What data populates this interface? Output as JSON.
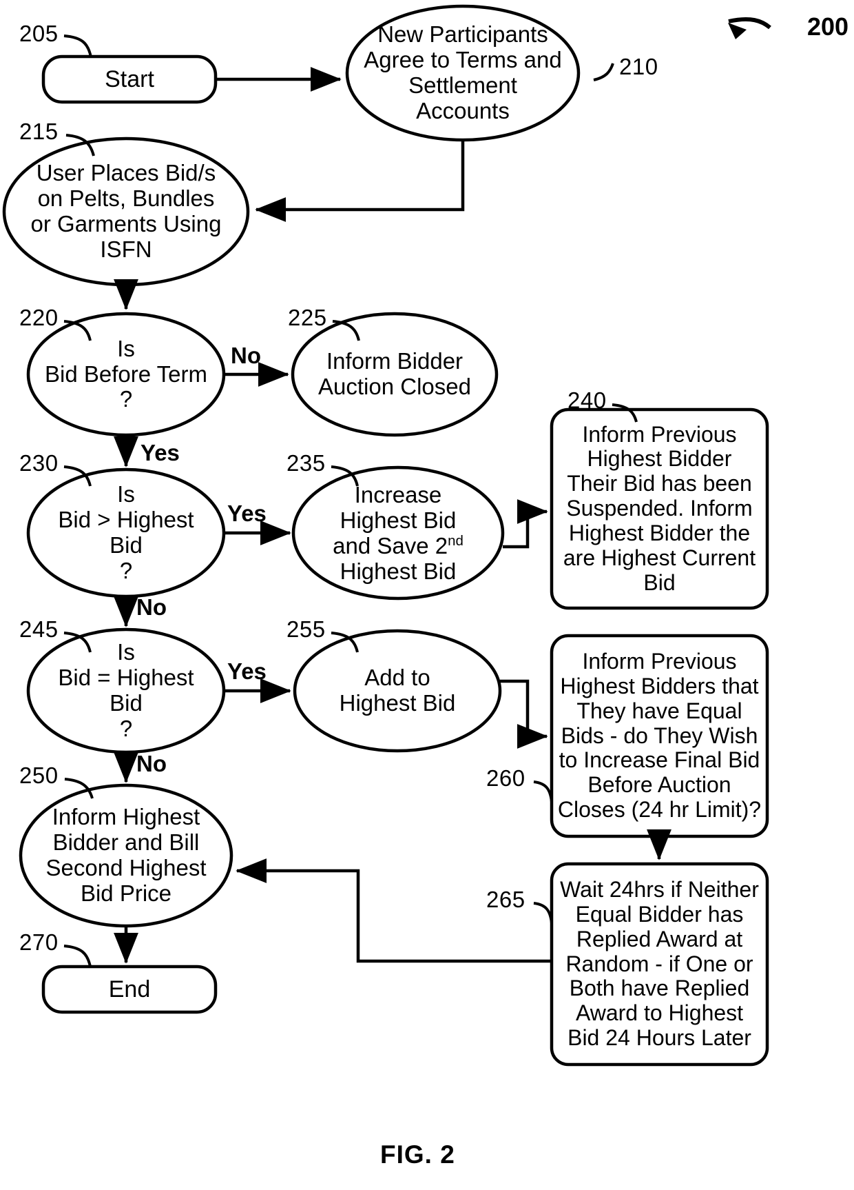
{
  "figure": {
    "caption": "FIG. 2",
    "overall_ref": "200"
  },
  "nodes": [
    {
      "ref": "205",
      "shape": "rounded-rect",
      "label": "Start",
      "name": "node-start"
    },
    {
      "ref": "210",
      "shape": "ellipse",
      "label": "New Participants\nAgree to Terms and\nSettlement\nAccounts",
      "name": "node-new-participants-agree"
    },
    {
      "ref": "215",
      "shape": "ellipse",
      "label": "User Places Bid/s\non Pelts, Bundles\nor Garments Using\nISFN",
      "name": "node-user-places-bids"
    },
    {
      "ref": "220",
      "shape": "ellipse",
      "label": "Is\nBid Before Term\n?",
      "name": "node-is-bid-before-term"
    },
    {
      "ref": "225",
      "shape": "ellipse",
      "label": "Inform Bidder\nAuction Closed",
      "name": "node-inform-bidder-auction-closed"
    },
    {
      "ref": "230",
      "shape": "ellipse",
      "label": "Is\nBid > Highest\nBid\n?",
      "name": "node-is-bid-greater-than-highest"
    },
    {
      "ref": "235",
      "shape": "ellipse",
      "label_pre": "Increase\nHighest Bid\nand Save 2",
      "label_sup": "nd",
      "label_post": "\nHighest Bid",
      "label": "Increase Highest Bid and Save 2nd Highest Bid",
      "name": "node-increase-highest-bid"
    },
    {
      "ref": "240",
      "shape": "rounded-rect",
      "label": "Inform Previous\nHighest Bidder\nTheir Bid has been\nSuspended. Inform\nHighest Bidder the\nare Highest Current\nBid",
      "name": "node-inform-previous-highest-bidder-suspended"
    },
    {
      "ref": "245",
      "shape": "ellipse",
      "label": "Is\nBid = Highest\nBid\n?",
      "name": "node-is-bid-equal-highest"
    },
    {
      "ref": "250",
      "shape": "ellipse",
      "label": "Inform Highest\nBidder and Bill\nSecond Highest\nBid Price",
      "name": "node-inform-highest-bidder-bill"
    },
    {
      "ref": "255",
      "shape": "ellipse",
      "label": "Add to\nHighest Bid",
      "name": "node-add-to-highest-bid"
    },
    {
      "ref": "260",
      "shape": "rounded-rect",
      "label": "Inform Previous\nHighest Bidders that\nThey have Equal\nBids - do They Wish\nto Increase Final Bid\nBefore Auction\nCloses (24 hr Limit)?",
      "name": "node-inform-previous-equal-bids"
    },
    {
      "ref": "265",
      "shape": "rounded-rect",
      "label": "Wait 24hrs if Neither\nEqual Bidder has\nReplied Award at\nRandom - if One or\nBoth have Replied\nAward to Highest\nBid 24 Hours Later",
      "name": "node-wait-24hrs"
    },
    {
      "ref": "270",
      "shape": "rounded-rect",
      "label": "End",
      "name": "node-end"
    }
  ],
  "edge_labels": {
    "term_no": "No",
    "term_yes": "Yes",
    "greater_yes": "Yes",
    "greater_no": "No",
    "equal_yes": "Yes",
    "equal_no": "No"
  },
  "colors": {
    "stroke": "#000000",
    "background": "#ffffff",
    "text": "#000000"
  }
}
